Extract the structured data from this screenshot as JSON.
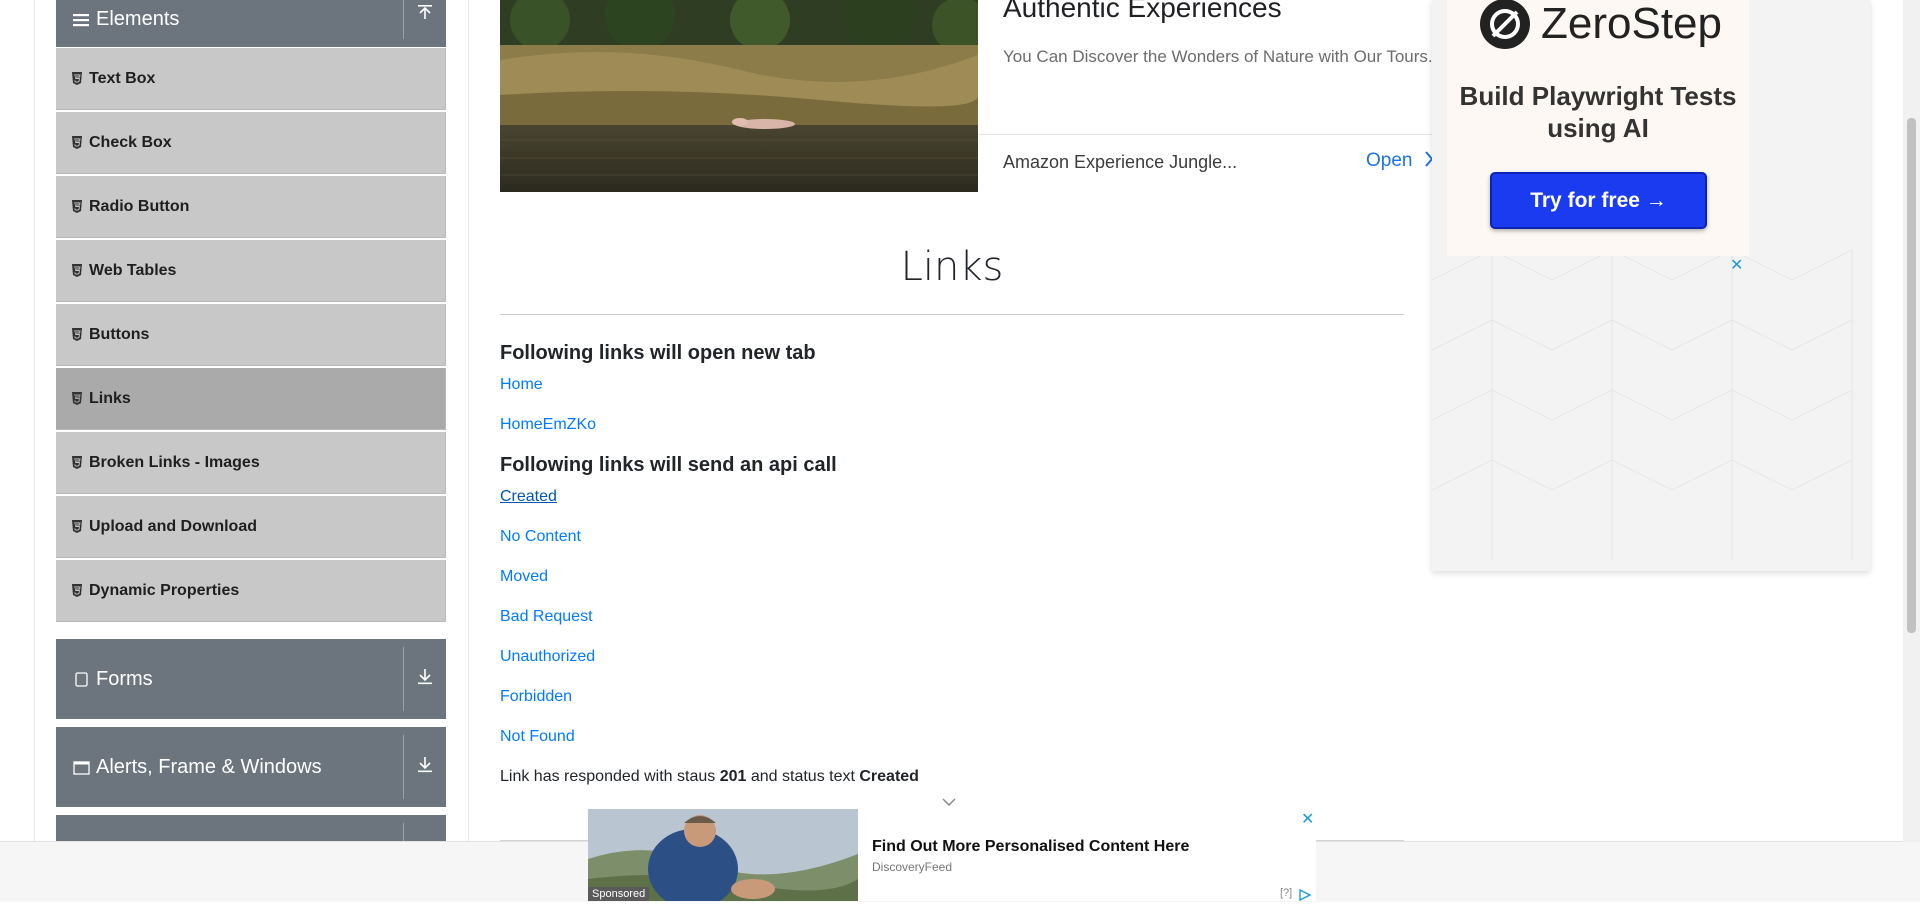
{
  "sidebar": {
    "elements_header": "Elements",
    "items": [
      {
        "label": "Text Box"
      },
      {
        "label": "Check Box"
      },
      {
        "label": "Radio Button"
      },
      {
        "label": "Web Tables"
      },
      {
        "label": "Buttons"
      },
      {
        "label": "Links"
      },
      {
        "label": "Broken Links - Images"
      },
      {
        "label": "Upload and Download"
      },
      {
        "label": "Dynamic Properties"
      }
    ],
    "active_item": "Links",
    "forms_header": "Forms",
    "alerts_header": "Alerts, Frame & Windows"
  },
  "top_ad": {
    "title": "Authentic Experiences",
    "description": "You Can Discover the Wonders of Nature with Our Tours.",
    "store": "Amazon Experience Jungle...",
    "open_label": "Open"
  },
  "main": {
    "page_title": "Links",
    "section_new_tab": "Following links will open new tab",
    "links_new_tab": [
      "Home",
      "HomeEmZKo"
    ],
    "section_api": "Following links will send an api call",
    "links_api": [
      "Created",
      "No Content",
      "Moved",
      "Bad Request",
      "Unauthorized",
      "Forbidden",
      "Not Found"
    ],
    "response_prefix": "Link has responded with staus",
    "response_code": "201",
    "response_middle": "and status text",
    "response_text": "Created"
  },
  "right_ad": {
    "brand": "ZeroStep",
    "tagline": "Build Playwright Tests using AI",
    "cta": "Try for free →",
    "close": "✕"
  },
  "bottom_ad": {
    "sponsored": "Sponsored",
    "title": "Find Out More Personalised Content Here",
    "source": "DiscoveryFeed",
    "info": "[?]",
    "close": "✕"
  },
  "colors": {
    "sidebar_header": "#6c757d",
    "menu_item": "#c8c8c8",
    "menu_item_active": "#aaaaaa",
    "link": "#007bff",
    "cta_button": "#1a3bef"
  }
}
